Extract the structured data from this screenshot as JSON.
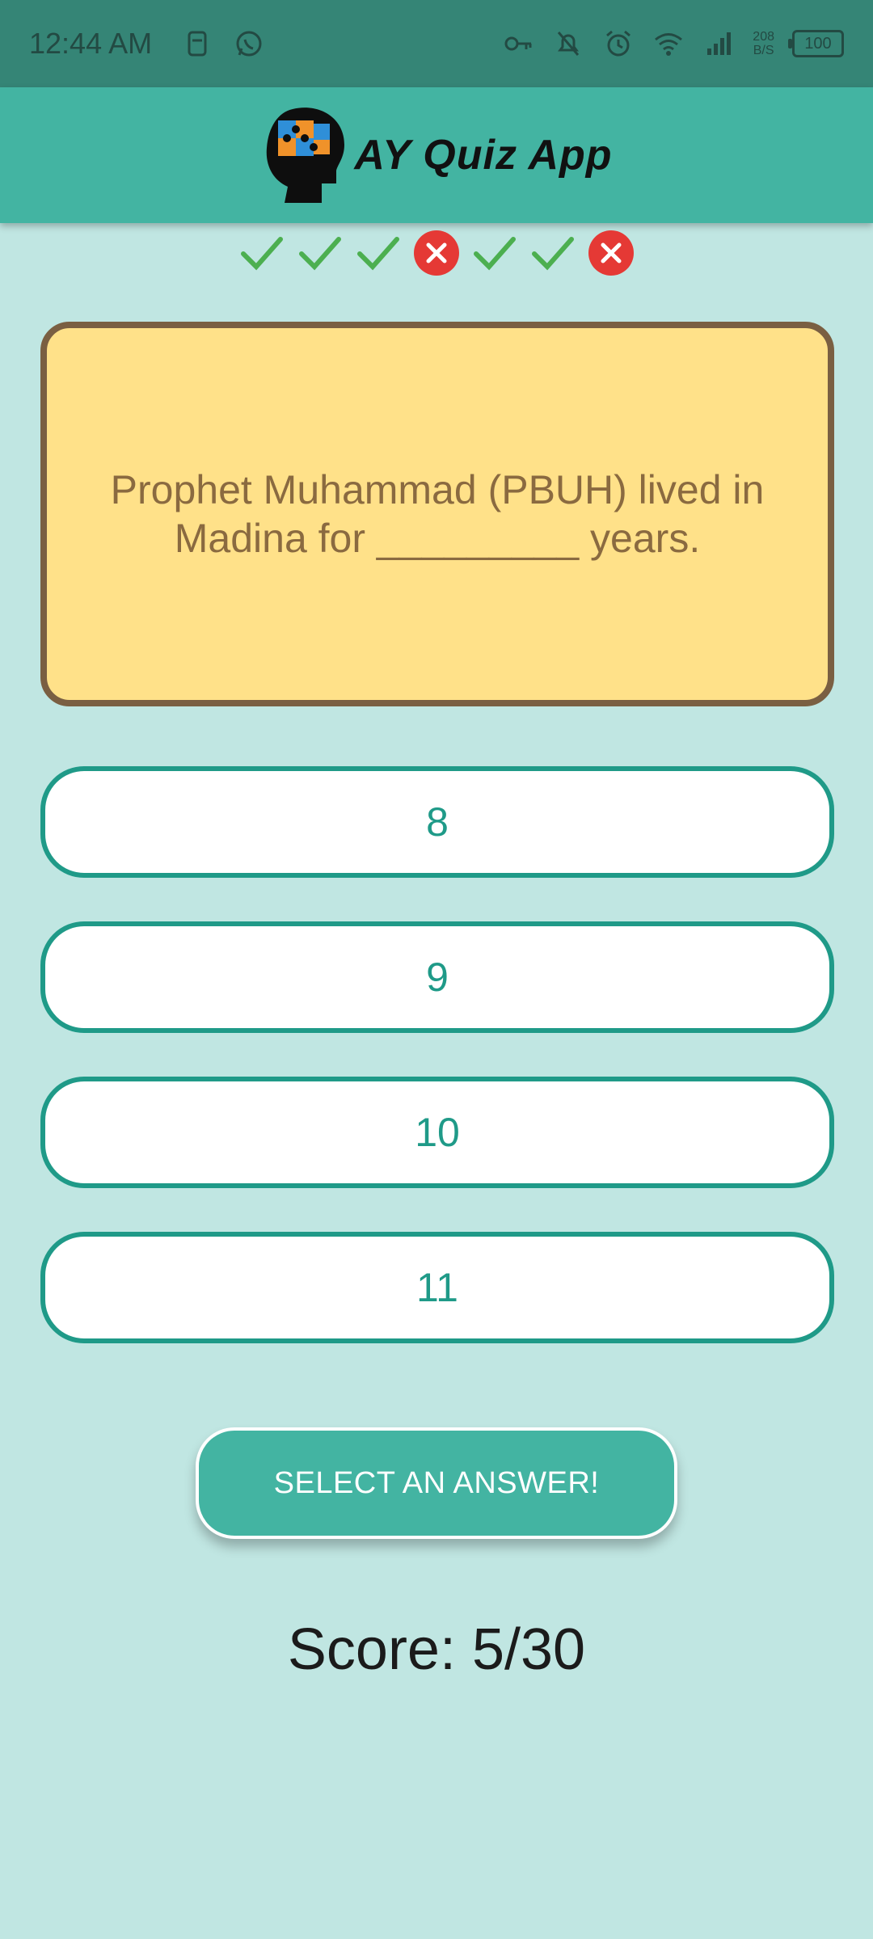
{
  "status_bar": {
    "time": "12:44 AM",
    "net_speed_value": "208",
    "net_speed_unit": "B/S",
    "battery": "100",
    "icons": [
      "sim-icon",
      "whatsapp-icon",
      "vpn-key-icon",
      "mute-bell-icon",
      "alarm-icon",
      "wifi-icon",
      "signal-icon",
      "battery-icon"
    ]
  },
  "app_bar": {
    "title": "AY Quiz App",
    "logo": "head-puzzle-logo"
  },
  "progress": [
    "correct",
    "correct",
    "correct",
    "wrong",
    "correct",
    "correct",
    "wrong"
  ],
  "question": {
    "text": "Prophet Muhammad (PBUH) lived in Madina for _________ years."
  },
  "options": [
    "8",
    "9",
    "10",
    "11"
  ],
  "action_button": {
    "label": "SELECT AN ANSWER!"
  },
  "score": {
    "text": "Score: 5/30"
  },
  "colors": {
    "background": "#c0e6e2",
    "app_bar": "#43b4a2",
    "status_bar": "#358576",
    "card_fill": "#ffe189",
    "card_border": "#7a5f42",
    "option_border": "#1f9a88",
    "correct": "#4caf50",
    "wrong": "#e53935"
  }
}
